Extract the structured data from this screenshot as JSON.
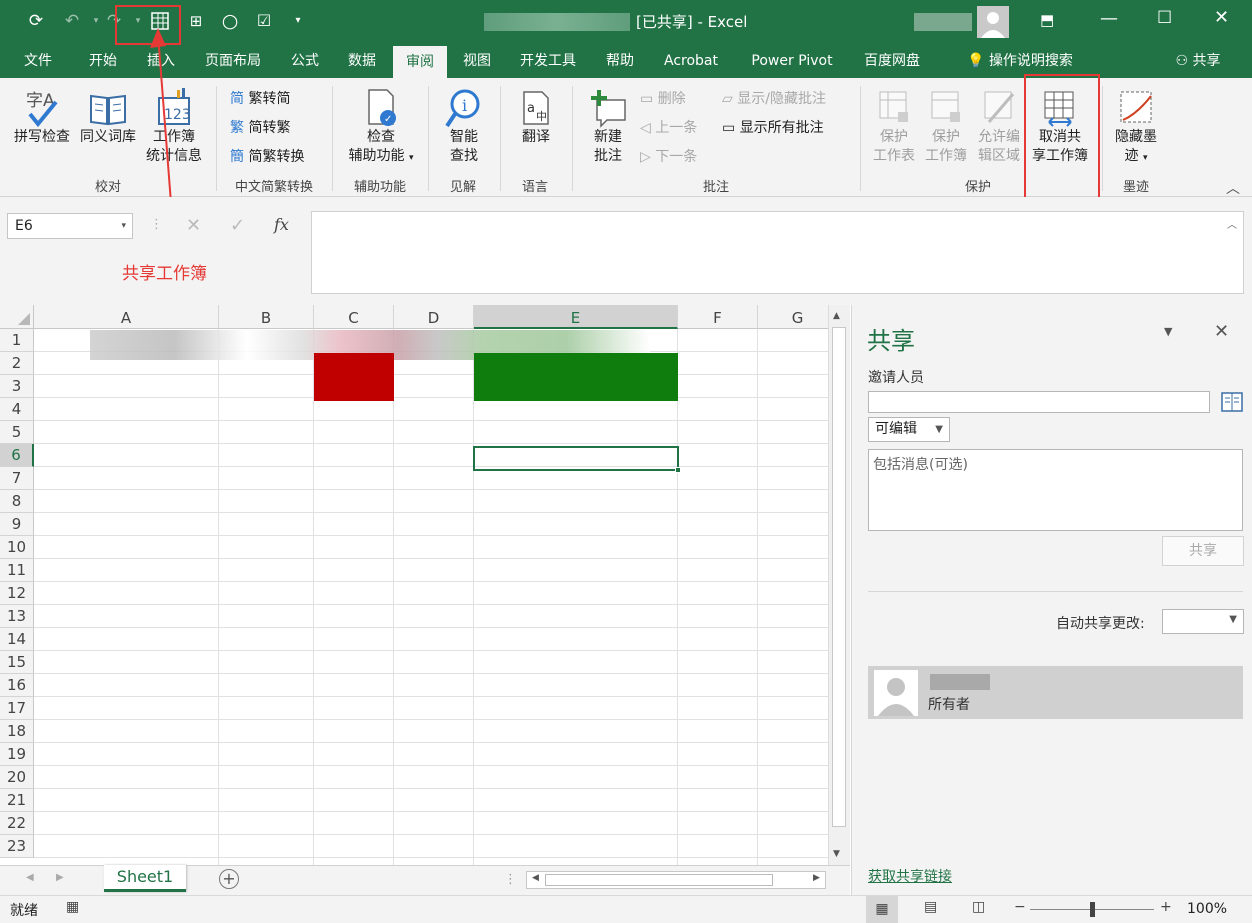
{
  "window": {
    "title_suffix": "[已共享]",
    "app": "Excel"
  },
  "tabs": [
    "文件",
    "开始",
    "插入",
    "页面布局",
    "公式",
    "数据",
    "审阅",
    "视图",
    "开发工具",
    "帮助",
    "Acrobat",
    "Power Pivot",
    "百度网盘"
  ],
  "tell_me": "操作说明搜索",
  "share_button": "共享",
  "ribbon": {
    "proofing": {
      "spell": "拼写检查",
      "thesaurus": "同义词库",
      "stats_1": "工作簿",
      "stats_2": "统计信息",
      "group": "校对"
    },
    "chinese": {
      "to_simplified": "繁转简",
      "to_traditional": "简转繁",
      "convert": "简繁转换",
      "group": "中文简繁转换"
    },
    "accessibility": {
      "check_1": "检查",
      "check_2": "辅助功能",
      "group": "辅助功能"
    },
    "insights": {
      "smart_1": "智能",
      "smart_2": "查找",
      "group": "见解"
    },
    "language": {
      "translate": "翻译",
      "group": "语言"
    },
    "comments": {
      "new_1": "新建",
      "new_2": "批注",
      "delete": "删除",
      "prev": "上一条",
      "next": "下一条",
      "show_hide": "显示/隐藏批注",
      "show_all": "显示所有批注",
      "group": "批注"
    },
    "protect": {
      "sheet_1": "保护",
      "sheet_2": "工作表",
      "book_1": "保护",
      "book_2": "工作簿",
      "allow_1": "允许编",
      "allow_2": "辑区域",
      "unshare_1": "取消共",
      "unshare_2": "享工作簿",
      "group": "保护"
    },
    "ink": {
      "hide_1": "隐藏墨",
      "hide_2": "迹",
      "group": "墨迹"
    }
  },
  "annotation": "共享工作簿",
  "namebox": "E6",
  "fx": "fx",
  "columns": [
    "A",
    "B",
    "C",
    "D",
    "E",
    "F",
    "G"
  ],
  "rows": [
    "1",
    "2",
    "3",
    "4",
    "5",
    "6",
    "7",
    "8",
    "9",
    "10",
    "11",
    "12",
    "13",
    "14",
    "15",
    "16",
    "17",
    "18",
    "19",
    "20",
    "21",
    "22",
    "23"
  ],
  "colors": {
    "accent": "#217346",
    "red_fill": "#c00000",
    "green_fill": "#0e7d0e",
    "annotation": "#e53935"
  },
  "sheet_tab": "Sheet1",
  "status": {
    "ready": "就绪",
    "zoom": "100%"
  },
  "share_pane": {
    "title": "共享",
    "invite_label": "邀请人员",
    "permission": "可编辑",
    "message_placeholder": "包括消息(可选)",
    "share_btn": "共享",
    "auto_share_label": "自动共享更改:",
    "owner_role": "所有者",
    "get_link": "获取共享链接"
  }
}
